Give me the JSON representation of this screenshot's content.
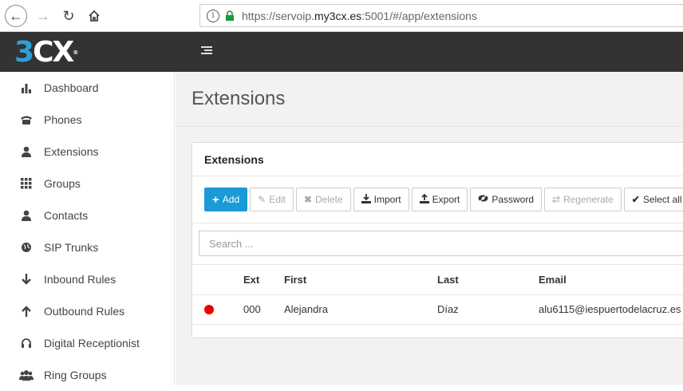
{
  "browser": {
    "url_prefix": "https://servoip.",
    "url_domain": "my3cx.es",
    "url_suffix": ":5001/#/app/extensions"
  },
  "app": {
    "logo_main": "3",
    "logo_cx": "CX",
    "logo_mark": "®",
    "brand_color": "#2d9fd8",
    "header_color": "#333333"
  },
  "sidebar": {
    "items": [
      {
        "label": "Dashboard",
        "icon": "bar-chart-icon"
      },
      {
        "label": "Phones",
        "icon": "phone-icon"
      },
      {
        "label": "Extensions",
        "icon": "user-icon"
      },
      {
        "label": "Groups",
        "icon": "grid-icon"
      },
      {
        "label": "Contacts",
        "icon": "user-icon"
      },
      {
        "label": "SIP Trunks",
        "icon": "globe-icon"
      },
      {
        "label": "Inbound Rules",
        "icon": "arrow-down-icon"
      },
      {
        "label": "Outbound Rules",
        "icon": "arrow-up-icon"
      },
      {
        "label": "Digital Receptionist",
        "icon": "headset-icon"
      },
      {
        "label": "Ring Groups",
        "icon": "users-icon"
      }
    ]
  },
  "main": {
    "page_title": "Extensions",
    "panel_title": "Extensions",
    "toolbar": {
      "add": "Add",
      "edit": "Edit",
      "delete": "Delete",
      "import": "Import",
      "export": "Export",
      "password": "Password",
      "regenerate": "Regenerate",
      "select_all": "Select all"
    },
    "search_placeholder": "Search ...",
    "table": {
      "columns": [
        "Ext",
        "First",
        "Last",
        "Email"
      ],
      "rows": [
        {
          "status_color": "#ee0000",
          "ext": "000",
          "first": "Alejandra",
          "last": "Díaz",
          "email": "alu6115@iespuertodelacruz.es"
        }
      ]
    }
  }
}
